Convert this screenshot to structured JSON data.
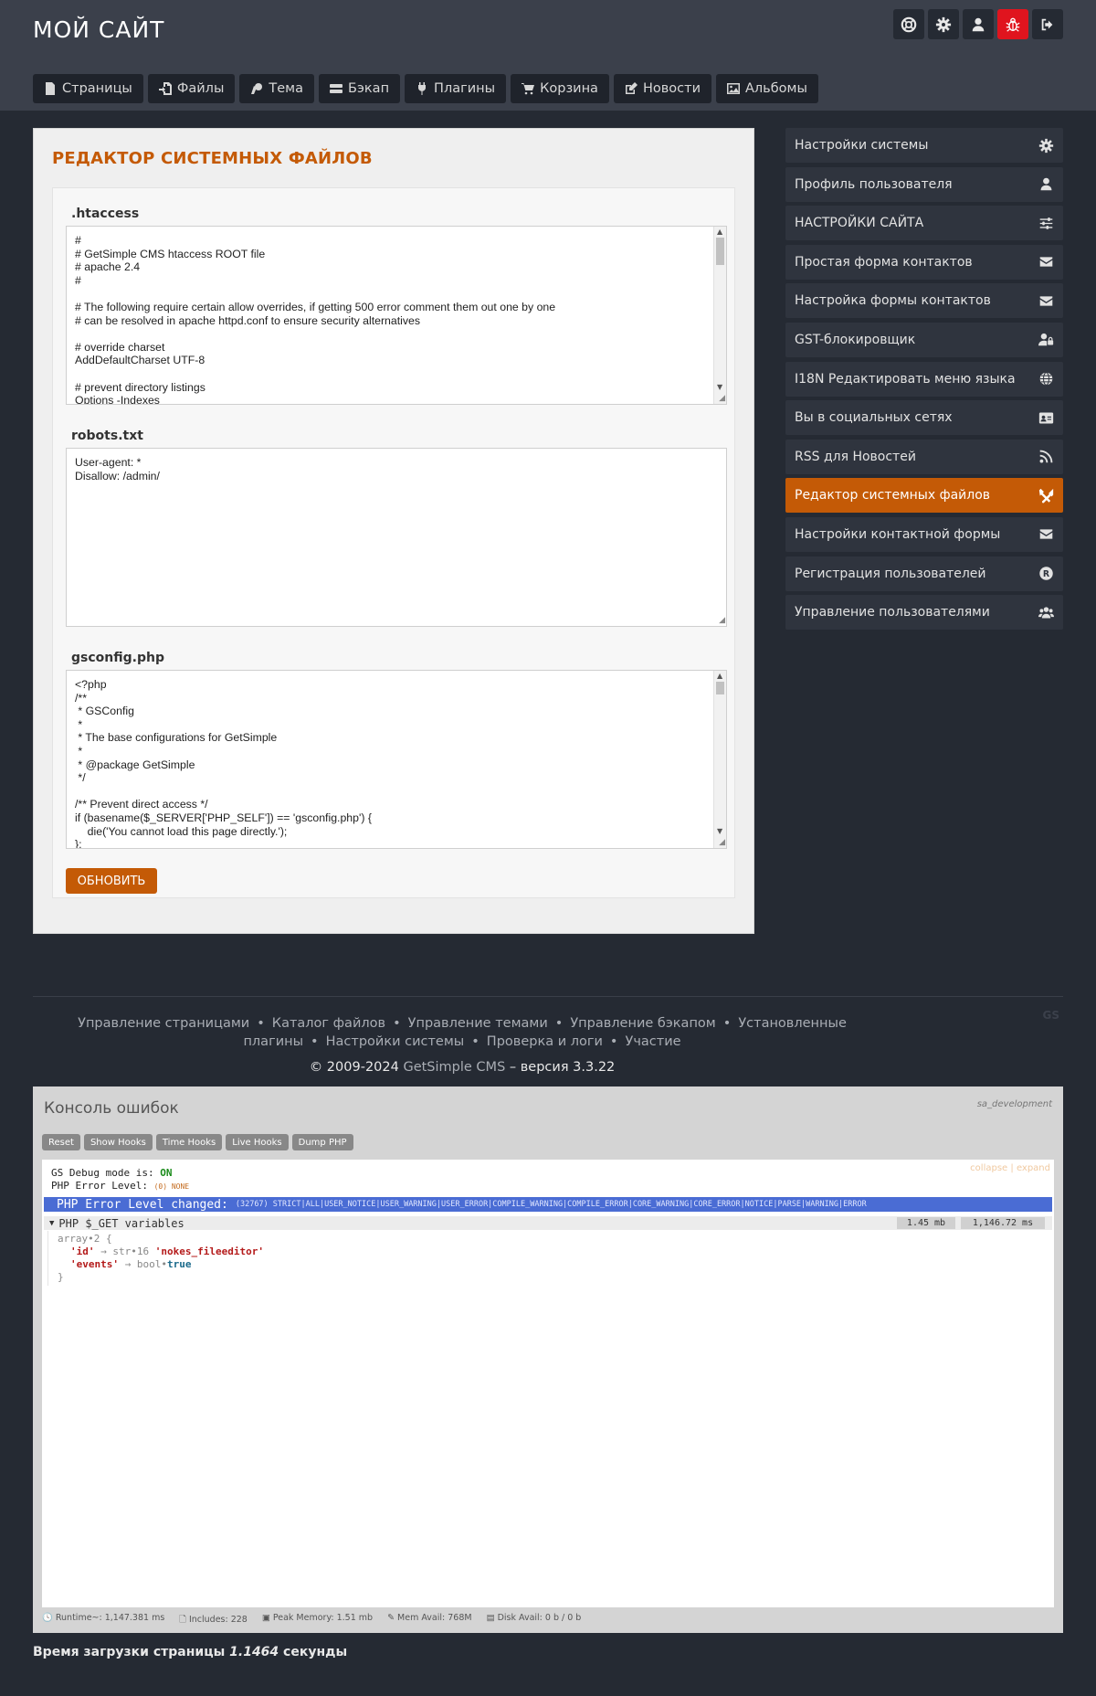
{
  "site": {
    "title": "МОЙ САЙТ"
  },
  "header_icons": [
    "support-icon",
    "gear-icon",
    "user-icon",
    "bug-icon",
    "logout-icon"
  ],
  "tabs": [
    {
      "label": "Страницы",
      "icon": "page-icon"
    },
    {
      "label": "Файлы",
      "icon": "file-import-icon"
    },
    {
      "label": "Тема",
      "icon": "theme-icon"
    },
    {
      "label": "Бэкап",
      "icon": "hdd-icon"
    },
    {
      "label": "Плагины",
      "icon": "plug-icon"
    },
    {
      "label": "Корзина",
      "icon": "cart-icon"
    },
    {
      "label": "Новости",
      "icon": "edit-icon"
    },
    {
      "label": "Альбомы",
      "icon": "image-icon"
    }
  ],
  "main": {
    "title": "РЕДАКТОР СИСТЕМНЫХ ФАЙЛОВ",
    "files": [
      {
        "name": ".htaccess",
        "content": "#\n# GetSimple CMS htaccess ROOT file\n# apache 2.4\n#\n\n# The following require certain allow overrides, if getting 500 error comment them out one by one\n# can be resolved in apache httpd.conf to ensure security alternatives\n\n# override charset\nAddDefaultCharset UTF-8\n\n# prevent directory listings\nOptions -Indexes"
      },
      {
        "name": "robots.txt",
        "content": "User-agent: *\nDisallow: /admin/"
      },
      {
        "name": "gsconfig.php",
        "content": "<?php\n/**\n * GSConfig\n *\n * The base configurations for GetSimple\n *\n * @package GetSimple\n */\n\n/** Prevent direct access */\nif (basename($_SERVER['PHP_SELF']) == 'gsconfig.php') {\n    die('You cannot load this page directly.');\n};"
      }
    ],
    "update_label": "ОБНОВИТЬ"
  },
  "sidebar": {
    "active_color": "#c45a06",
    "items": [
      {
        "label": "Настройки системы",
        "icon": "gear-icon"
      },
      {
        "label": "Профиль пользователя",
        "icon": "user-icon"
      },
      {
        "label": "НАСТРОЙКИ САЙТА",
        "icon": "sliders-icon"
      },
      {
        "label": "Простая форма контактов",
        "icon": "envelope-icon"
      },
      {
        "label": "Настройка формы контактов",
        "icon": "envelope-icon"
      },
      {
        "label": "GST-блокировщик",
        "icon": "user-lock-icon"
      },
      {
        "label": "I18N Редактировать меню языка",
        "icon": "globe-icon"
      },
      {
        "label": "Вы в социальных сетях",
        "icon": "id-card-icon"
      },
      {
        "label": "RSS для Новостей",
        "icon": "rss-icon"
      },
      {
        "label": "Редактор системных файлов",
        "icon": "tools-icon"
      },
      {
        "label": "Настройки контактной формы",
        "icon": "envelope-icon"
      },
      {
        "label": "Регистрация пользователей",
        "icon": "registered-icon"
      },
      {
        "label": "Управление пользователями",
        "icon": "users-icon"
      }
    ]
  },
  "footer": {
    "links": [
      "Управление страницами",
      "Каталог файлов",
      "Управление темами",
      "Управление бэкапом",
      "Установленные плагины",
      "Настройки системы",
      "Проверка и логи",
      "Участие"
    ],
    "separator": "•",
    "gs_logo": "GS",
    "copyright_prefix": "© 2009-2024",
    "cms_name": "GetSimple CMS",
    "version": "– версия 3.3.22"
  },
  "console": {
    "title": "Консоль ошибок",
    "env": "sa_development",
    "buttons": [
      "Reset",
      "Show Hooks",
      "Time Hooks",
      "Live Hooks",
      "Dump PHP"
    ],
    "collapse": "collapse",
    "expand": "expand",
    "divider": "|",
    "debug_label": "GS Debug mode is:",
    "debug_value": "ON",
    "error_level_label": "PHP Error Level:",
    "error_level_value": "(0) NONE",
    "error_changed": "PHP Error Level changed:",
    "error_flags": "(32767) STRICT|ALL|USER_NOTICE|USER_WARNING|USER_ERROR|COMPILE_WARNING|COMPILE_ERROR|CORE_WARNING|CORE_ERROR|NOTICE|PARSE|WARNING|ERROR",
    "get_title": "PHP $_GET variables",
    "get_mem": "1.45 mb",
    "get_time": "1,146.72 ms",
    "array_line": "array•2 {",
    "entry1_key": "'id'",
    "entry1_type": "→ str•16",
    "entry1_value": "'nokes_fileeditor'",
    "entry2_key": "'events'",
    "entry2_type": "→ bool•",
    "entry2_value": "true",
    "array_close": "}",
    "status": {
      "runtime": "Runtime~: 1,147.381 ms",
      "includes": "Includes: 228",
      "peak_memory": "Peak Memory: 1.51 mb",
      "mem_avail": "Mem Avail: 768M",
      "disk_avail": "Disk Avail: 0 b / 0 b"
    }
  },
  "load_time": {
    "prefix": "Время загрузки страницы",
    "value": "1.1464",
    "suffix": "секунды"
  }
}
